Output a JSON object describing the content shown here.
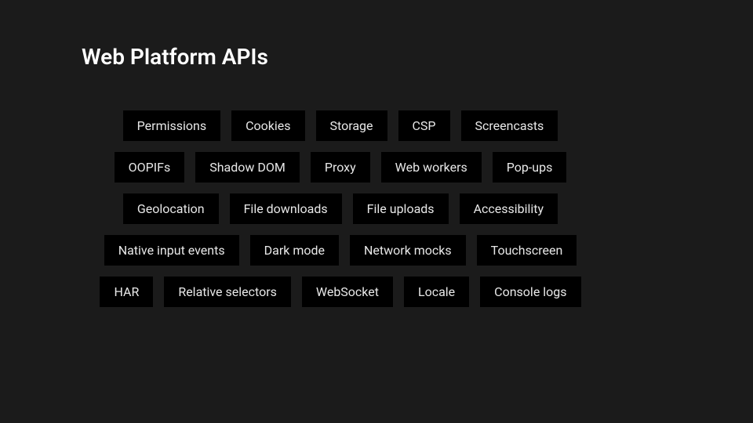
{
  "title": "Web Platform APIs",
  "rows": [
    [
      "Permissions",
      "Cookies",
      "Storage",
      "CSP",
      "Screencasts"
    ],
    [
      "OOPIFs",
      "Shadow DOM",
      "Proxy",
      "Web workers",
      "Pop-ups"
    ],
    [
      "Geolocation",
      "File downloads",
      "File uploads",
      "Accessibility"
    ],
    [
      "Native input events",
      "Dark mode",
      "Network mocks",
      "Touchscreen"
    ],
    [
      "HAR",
      "Relative selectors",
      "WebSocket",
      "Locale",
      "Console logs"
    ]
  ]
}
